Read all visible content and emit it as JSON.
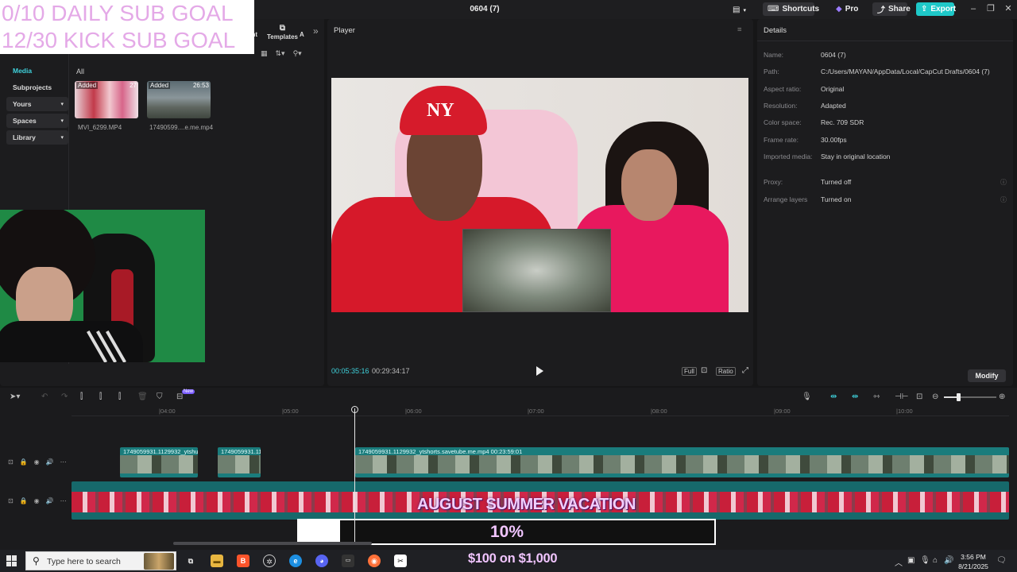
{
  "titlebar": {
    "project_title": "0604 (7)",
    "shortcuts_label": "Shortcuts",
    "pro_label": "Pro",
    "share_label": "Share",
    "export_label": "Export"
  },
  "media_panel": {
    "tabs": [
      {
        "label": "ent",
        "icon": "text-icon"
      },
      {
        "label": "Templates",
        "icon": "templates-icon"
      },
      {
        "label": "A",
        "icon": "audio-icon"
      }
    ],
    "sidebar": [
      {
        "label": "Media",
        "active": true,
        "expandable": false
      },
      {
        "label": "Subprojects",
        "active": false,
        "expandable": false
      },
      {
        "label": "Yours",
        "active": false,
        "expandable": true
      },
      {
        "label": "Spaces",
        "active": false,
        "expandable": true
      },
      {
        "label": "Library",
        "active": false,
        "expandable": true
      }
    ],
    "filter_label": "All",
    "items": [
      {
        "name": "MVI_6299.MP4",
        "status": "Added",
        "duration": "27"
      },
      {
        "name": "17490599....e.me.mp4",
        "status": "Added",
        "duration": "26:53"
      }
    ]
  },
  "overlay": {
    "daily_goal": "0/10 DAILY SUB GOAL",
    "kick_goal": "12/30 KICK SUB GOAL",
    "banner": "AUGUST SUMMER VACATION",
    "progress_text": "10%",
    "progress_fraction": 0.1,
    "money": "$100 on $1,000"
  },
  "player": {
    "title": "Player",
    "current_time": "00:05:35:16",
    "total_time": "00:29:34:17",
    "buttons": {
      "full": "Full",
      "ratio": "Ratio"
    }
  },
  "details": {
    "title": "Details",
    "rows": [
      {
        "key": "Name:",
        "value": "0604 (7)"
      },
      {
        "key": "Path:",
        "value": "C:/Users/MAYAN/AppData/Local/CapCut Drafts/0604 (7)"
      },
      {
        "key": "Aspect ratio:",
        "value": "Original"
      },
      {
        "key": "Resolution:",
        "value": "Adapted"
      },
      {
        "key": "Color space:",
        "value": "Rec. 709 SDR"
      },
      {
        "key": "Frame rate:",
        "value": "30.00fps"
      },
      {
        "key": "Imported media:",
        "value": "Stay in original location"
      }
    ],
    "extra_rows": [
      {
        "key": "Proxy:",
        "value": "Turned off"
      },
      {
        "key": "Arrange layers",
        "value": "Turned on"
      }
    ],
    "modify_label": "Modify"
  },
  "timeline": {
    "ruler": [
      "|04:00",
      "|05:00",
      "|06:00",
      "|07:00",
      "|08:00",
      "|09:00",
      "|10:00"
    ],
    "clips": [
      {
        "label": "1749059931.1129932_ytshu"
      },
      {
        "label": "1749059931.11"
      },
      {
        "label": "1749059931.1129932_ytshorts.savetube.me.mp4   00:23:59:01"
      }
    ],
    "zoom_level": 0.28,
    "new_badge": "New"
  },
  "taskbar": {
    "search_placeholder": "Type here to search",
    "time": "3:56 PM",
    "date": "8/21/2025"
  },
  "colors": {
    "accent": "#1ec8c8",
    "clip_teal": "#1a7c7c",
    "overlay_pink": "#f1c5ff"
  }
}
